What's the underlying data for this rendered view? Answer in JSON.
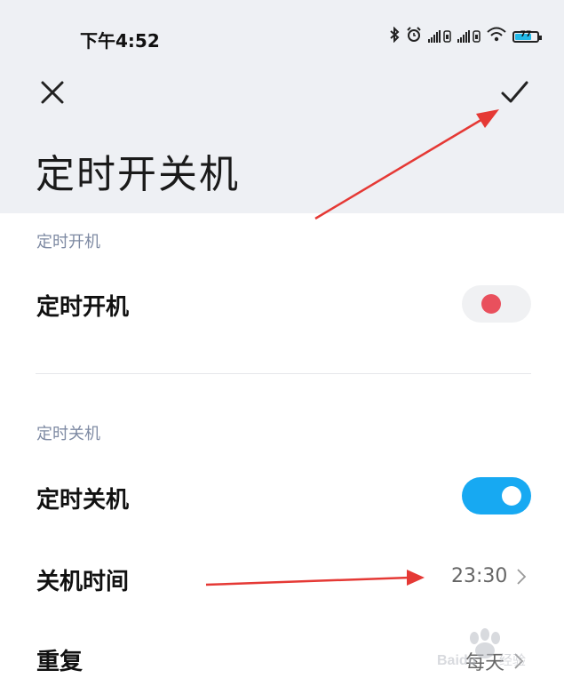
{
  "status_bar": {
    "time": "下午4:52",
    "battery_level": "77",
    "icons": [
      "bluetooth-icon",
      "alarm-icon",
      "signal-icon",
      "signal-icon",
      "wifi-icon",
      "battery-icon"
    ]
  },
  "toolbar": {
    "close_icon": "close-icon",
    "confirm_icon": "check-icon"
  },
  "page": {
    "title": "定时开关机"
  },
  "power_on_section": {
    "header": "定时开机",
    "toggle_label": "定时开机",
    "enabled": false
  },
  "power_off_section": {
    "header": "定时关机",
    "toggle_label": "定时关机",
    "enabled": true,
    "time_label": "关机时间",
    "time_value": "23:30",
    "repeat_label": "重复",
    "repeat_value": "每天"
  },
  "watermark": {
    "brand": "Baidu",
    "sub": "经验"
  },
  "colors": {
    "header_bg": "#eef0f4",
    "accent": "#17a9f2",
    "off_knob": "#e9505d",
    "section_header": "#7e8aa3",
    "annotation_arrow": "#e53935"
  }
}
